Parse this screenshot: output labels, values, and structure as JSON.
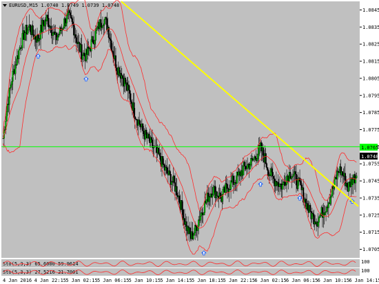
{
  "header": {
    "dropdown_icon": "triangle-down-icon",
    "symbol_info": "EURUSD,M15  1.0740 1.0749 1.0739 1.0748"
  },
  "colors": {
    "background": "#c0c0c0",
    "bull_candle": "#000000",
    "bear_candle": "#000000",
    "bull_body": "#00c000",
    "bear_body": "#000000",
    "bollinger": "#ff2a2a",
    "trendline": "#ffff00",
    "hline": "#00ff00",
    "arrow": "#0050ff"
  },
  "chart_data": {
    "type": "candlestick",
    "symbol": "EURUSD",
    "timeframe": "M15",
    "price_axis": {
      "ticks": [
        "1.0845",
        "1.0835",
        "1.0825",
        "1.0815",
        "1.0805",
        "1.0795",
        "1.0785",
        "1.0775",
        "1.0765",
        "1.0755",
        "1.0745",
        "1.0735",
        "1.0725",
        "1.0715",
        "1.0705"
      ],
      "ylim": [
        1.07,
        1.085
      ]
    },
    "time_axis": {
      "ticks": [
        "4 Jan 2016",
        "4 Jan 22:15",
        "5 Jan 02:15",
        "5 Jan 06:15",
        "5 Jan 10:15",
        "5 Jan 14:15",
        "5 Jan 18:15",
        "5 Jan 22:15",
        "6 Jan 02:15",
        "6 Jan 06:15",
        "6 Jan 10:15",
        "6 Jan 14:15"
      ]
    },
    "current_price": "1.0748",
    "hline_price": "1.0765",
    "hline_value": 1.0765,
    "close_path": [
      1.077,
      1.079,
      1.0805,
      1.0815,
      1.0825,
      1.0832,
      1.0835,
      1.083,
      1.0828,
      1.0836,
      1.084,
      1.0835,
      1.0828,
      1.0832,
      1.0838,
      1.0841,
      1.0836,
      1.0826,
      1.082,
      1.0818,
      1.0824,
      1.083,
      1.0836,
      1.084,
      1.0835,
      1.0822,
      1.0812,
      1.0808,
      1.0802,
      1.0795,
      1.0786,
      1.078,
      1.0774,
      1.077,
      1.0766,
      1.0762,
      1.0758,
      1.0752,
      1.0748,
      1.0744,
      1.0738,
      1.0728,
      1.0718,
      1.0712,
      1.0716,
      1.0724,
      1.073,
      1.0736,
      1.074,
      1.0738,
      1.0735,
      1.074,
      1.0743,
      1.0745,
      1.0748,
      1.0752,
      1.0754,
      1.0756,
      1.076,
      1.0764,
      1.0758,
      1.075,
      1.0746,
      1.0744,
      1.0742,
      1.0748,
      1.075,
      1.0746,
      1.0742,
      1.0735,
      1.0728,
      1.0724,
      1.0722,
      1.0726,
      1.073,
      1.0736,
      1.0744,
      1.0752,
      1.0748,
      1.0741,
      1.0746,
      1.0748
    ],
    "indicator_panels": [
      {
        "label": "Sto(5,3,3) 65.6000 59.9614",
        "scale_max": "100",
        "scale_min": "0"
      },
      {
        "label": "Sto(5,3,3) 27.5216 21.7001",
        "scale_max": "100",
        "scale_min": "0"
      }
    ],
    "arrows_up": [
      {
        "index": 8
      },
      {
        "index": 19
      },
      {
        "index": 46
      },
      {
        "index": 59
      },
      {
        "index": 68
      },
      {
        "index": 80
      }
    ]
  }
}
